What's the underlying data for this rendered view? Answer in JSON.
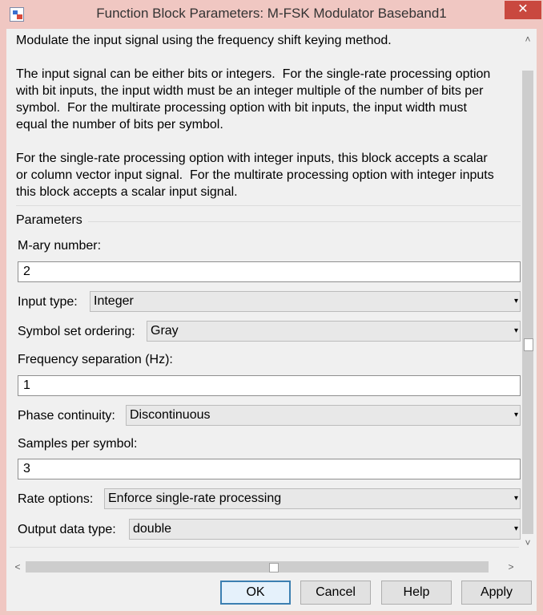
{
  "window": {
    "title": "Function Block Parameters: M-FSK Modulator Baseband1",
    "close_glyph": "✕"
  },
  "description": [
    "Modulate the input signal using the frequency shift keying method.",
    "The input signal can be either bits or integers.  For the single-rate processing option",
    "with bit inputs, the input width must be an integer multiple of the number of bits per",
    "symbol.  For the multirate processing option with bit inputs, the input width must",
    "equal the number of bits per symbol.",
    "For the single-rate processing option with integer inputs, this block accepts a scalar",
    "or column vector input signal.  For the multirate processing option with integer inputs",
    "this block accepts a scalar input signal."
  ],
  "parameters": {
    "group_label": "Parameters",
    "mary_label": "M-ary number:",
    "mary_value": "2",
    "input_type_label": "Input type:",
    "input_type_value": "Integer",
    "symbol_ordering_label": "Symbol set ordering:",
    "symbol_ordering_value": "Gray",
    "freq_sep_label": "Frequency separation (Hz):",
    "freq_sep_value": "1",
    "phase_label": "Phase continuity:",
    "phase_value": "Discontinuous",
    "samples_label": "Samples per symbol:",
    "samples_value": "3",
    "rate_label": "Rate options:",
    "rate_value": "Enforce single-rate processing",
    "output_type_label": "Output data type:",
    "output_type_value": "double",
    "dropdown_glyph": "▾"
  },
  "scrollbars": {
    "up": "˄",
    "down": "˅",
    "left": "<",
    "right": ">"
  },
  "buttons": {
    "ok": "OK",
    "cancel": "Cancel",
    "help": "Help",
    "apply": "Apply"
  },
  "colors": {
    "title_bar": "#f0c7c2",
    "close_button": "#c9483f",
    "default_button_border": "#3c7fb1"
  }
}
